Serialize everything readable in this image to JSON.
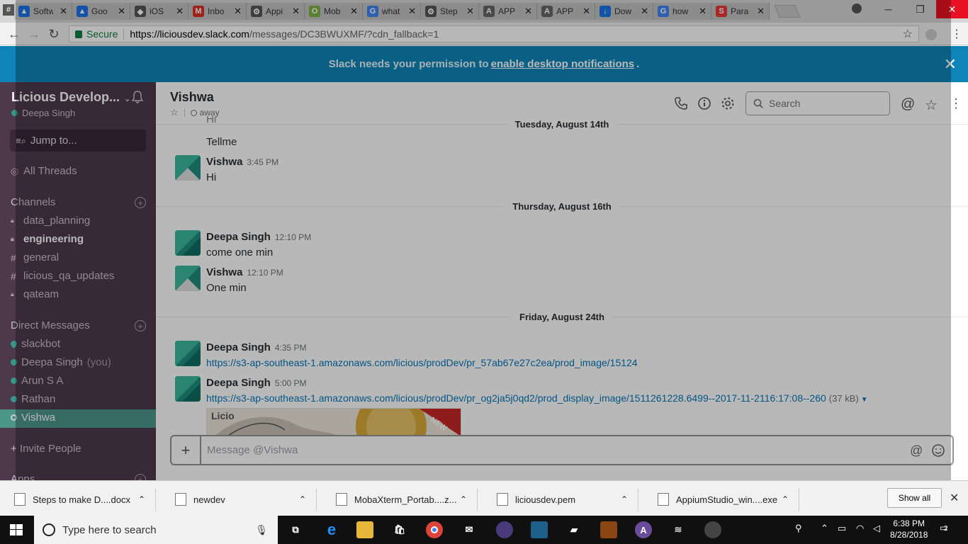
{
  "browser": {
    "tabs": [
      {
        "title": "Softw",
        "fav_color": "#1a73e8",
        "fav_glyph": "▲"
      },
      {
        "title": "Goo",
        "fav_color": "#1a73e8",
        "fav_glyph": "▲"
      },
      {
        "title": "iOS",
        "fav_color": "#555555",
        "fav_glyph": "◆"
      },
      {
        "title": "Inbo",
        "fav_color": "#d93025",
        "fav_glyph": "M"
      },
      {
        "title": "Appi",
        "fav_color": "#555555",
        "fav_glyph": "⚙"
      },
      {
        "title": "Mob",
        "fav_color": "#7cb342",
        "fav_glyph": "O"
      },
      {
        "title": "what",
        "fav_color": "#4285f4",
        "fav_glyph": "G"
      },
      {
        "title": "Step",
        "fav_color": "#555555",
        "fav_glyph": "⚙"
      },
      {
        "title": "APP",
        "fav_color": "#666666",
        "fav_glyph": "A"
      },
      {
        "title": "APP",
        "fav_color": "#666666",
        "fav_glyph": "A"
      },
      {
        "title": "Dow",
        "fav_color": "#1a73e8",
        "fav_glyph": "↓"
      },
      {
        "title": "how",
        "fav_color": "#4285f4",
        "fav_glyph": "G"
      },
      {
        "title": "Para",
        "fav_color": "#e53935",
        "fav_glyph": "S"
      }
    ],
    "secure_label": "Secure",
    "url_domain": "https://liciousdev.slack.com",
    "url_path": "/messages/DC3BWUXMF/?cdn_fallback=1"
  },
  "notification": {
    "prefix": "Slack needs your permission to",
    "link": "enable desktop notifications",
    "suffix": "."
  },
  "sidebar": {
    "workspace": "Licious Develop...",
    "user": "Deepa Singh",
    "jump": "Jump to...",
    "all_threads": "All Threads",
    "channels_header": "Channels",
    "channels": [
      {
        "name": "data_planning",
        "icon": "lock-icon"
      },
      {
        "name": "engineering",
        "icon": "lock-icon"
      },
      {
        "name": "general",
        "icon": "hash-icon"
      },
      {
        "name": "licious_qa_updates",
        "icon": "hash-icon"
      },
      {
        "name": "qateam",
        "icon": "lock-icon"
      }
    ],
    "dm_header": "Direct Messages",
    "dms": [
      {
        "name": "slackbot",
        "suffix": ""
      },
      {
        "name": "Deepa Singh",
        "suffix": "(you)"
      },
      {
        "name": "Arun S A",
        "suffix": ""
      },
      {
        "name": "Rathan",
        "suffix": ""
      },
      {
        "name": "Vishwa",
        "suffix": ""
      }
    ],
    "invite": "+ Invite People",
    "apps": "Apps"
  },
  "header": {
    "title": "Vishwa",
    "status": "away",
    "search_placeholder": "Search"
  },
  "messages": {
    "partial_top": "Hi",
    "days": [
      "Tuesday, August 14th",
      "Thursday, August 16th",
      "Friday, August 24th"
    ],
    "tellme": "Tellme",
    "items": [
      {
        "author": "Vishwa",
        "time": "3:45 PM",
        "text": "Hi"
      },
      {
        "author": "Deepa Singh",
        "time": "12:10 PM",
        "text": "come one min"
      },
      {
        "author": "Vishwa",
        "time": "12:10 PM",
        "text": "One min"
      },
      {
        "author": "Deepa Singh",
        "time": "4:35 PM",
        "text": "https://s3-ap-southeast-1.amazonaws.com/licious/prodDev/pr_57ab67e27c2ea/prod_image/15124"
      },
      {
        "author": "Deepa Singh",
        "time": "5:00 PM",
        "text": "https://s3-ap-southeast-1.amazonaws.com/licious/prodDev/pr_og2ja5j0qd2/prod_display_image/1511261228.6499--2017-11-2116:17:08--260",
        "size": "(37 kB)"
      }
    ],
    "preview_brand": "Licio",
    "preview_badge": "NEW"
  },
  "composer": {
    "placeholder": "Message @Vishwa"
  },
  "downloads": {
    "items": [
      "Steps to make D....docx",
      "newdev",
      "MobaXterm_Portab....z...",
      "liciousdev.pem",
      "AppiumStudio_win....exe"
    ],
    "show_all": "Show all"
  },
  "taskbar": {
    "search": "Type here to search",
    "time": "6:38 PM",
    "date": "8/28/2018",
    "notif_count": "2"
  }
}
